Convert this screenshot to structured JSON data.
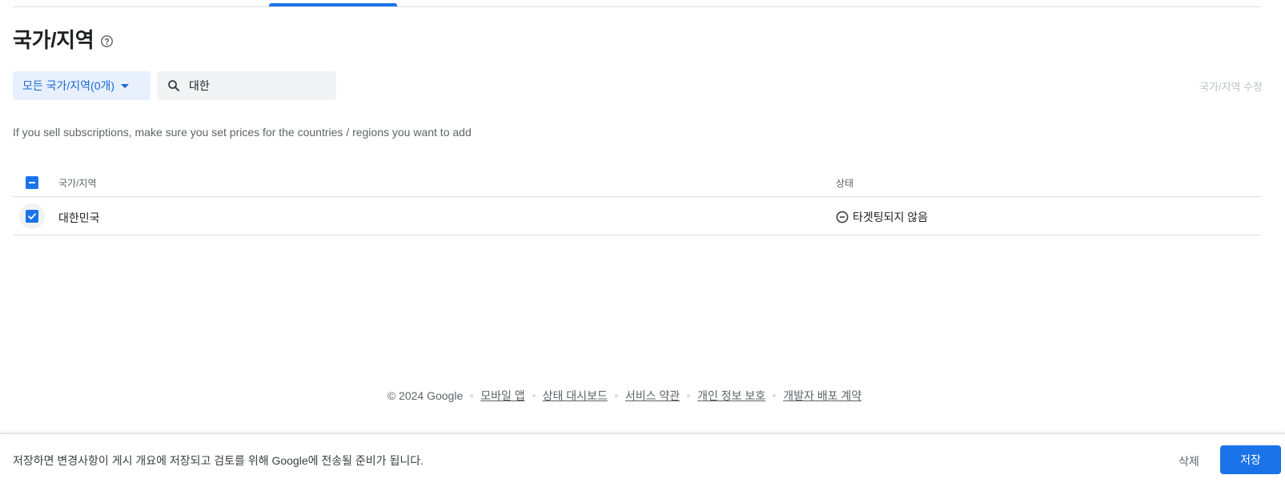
{
  "page": {
    "title": "국가/지역",
    "help_icon": "help-circle-icon"
  },
  "toolbar": {
    "filter_label": "모든 국가/지역(0개)",
    "search_value": "대한",
    "search_icon": "search-icon",
    "edit_label": "국가/지역 수정"
  },
  "info_text": "If you sell subscriptions, make sure you set prices for the countries / regions you want to add",
  "table": {
    "columns": [
      "국가/지역",
      "상태"
    ],
    "rows": [
      {
        "name": "대한민국",
        "status": "타겟팅되지 않음",
        "status_icon": "minus-circle-icon",
        "checked": true
      }
    ]
  },
  "footer": {
    "copyright": "© 2024 Google",
    "links": [
      "모바일 앱",
      "상태 대시보드",
      "서비스 약관",
      "개인 정보 보호",
      "개발자 배포 계약"
    ]
  },
  "bottom_bar": {
    "message": "저장하면 변경사항이 게시 개요에 저장되고 검토를 위해 Google에 전송될 준비가 됩니다.",
    "discard_label": "삭제",
    "save_label": "저장"
  },
  "colors": {
    "accent": "#1a73e8",
    "filter_bg": "#e8f0fe",
    "search_bg": "#f1f3f4"
  }
}
